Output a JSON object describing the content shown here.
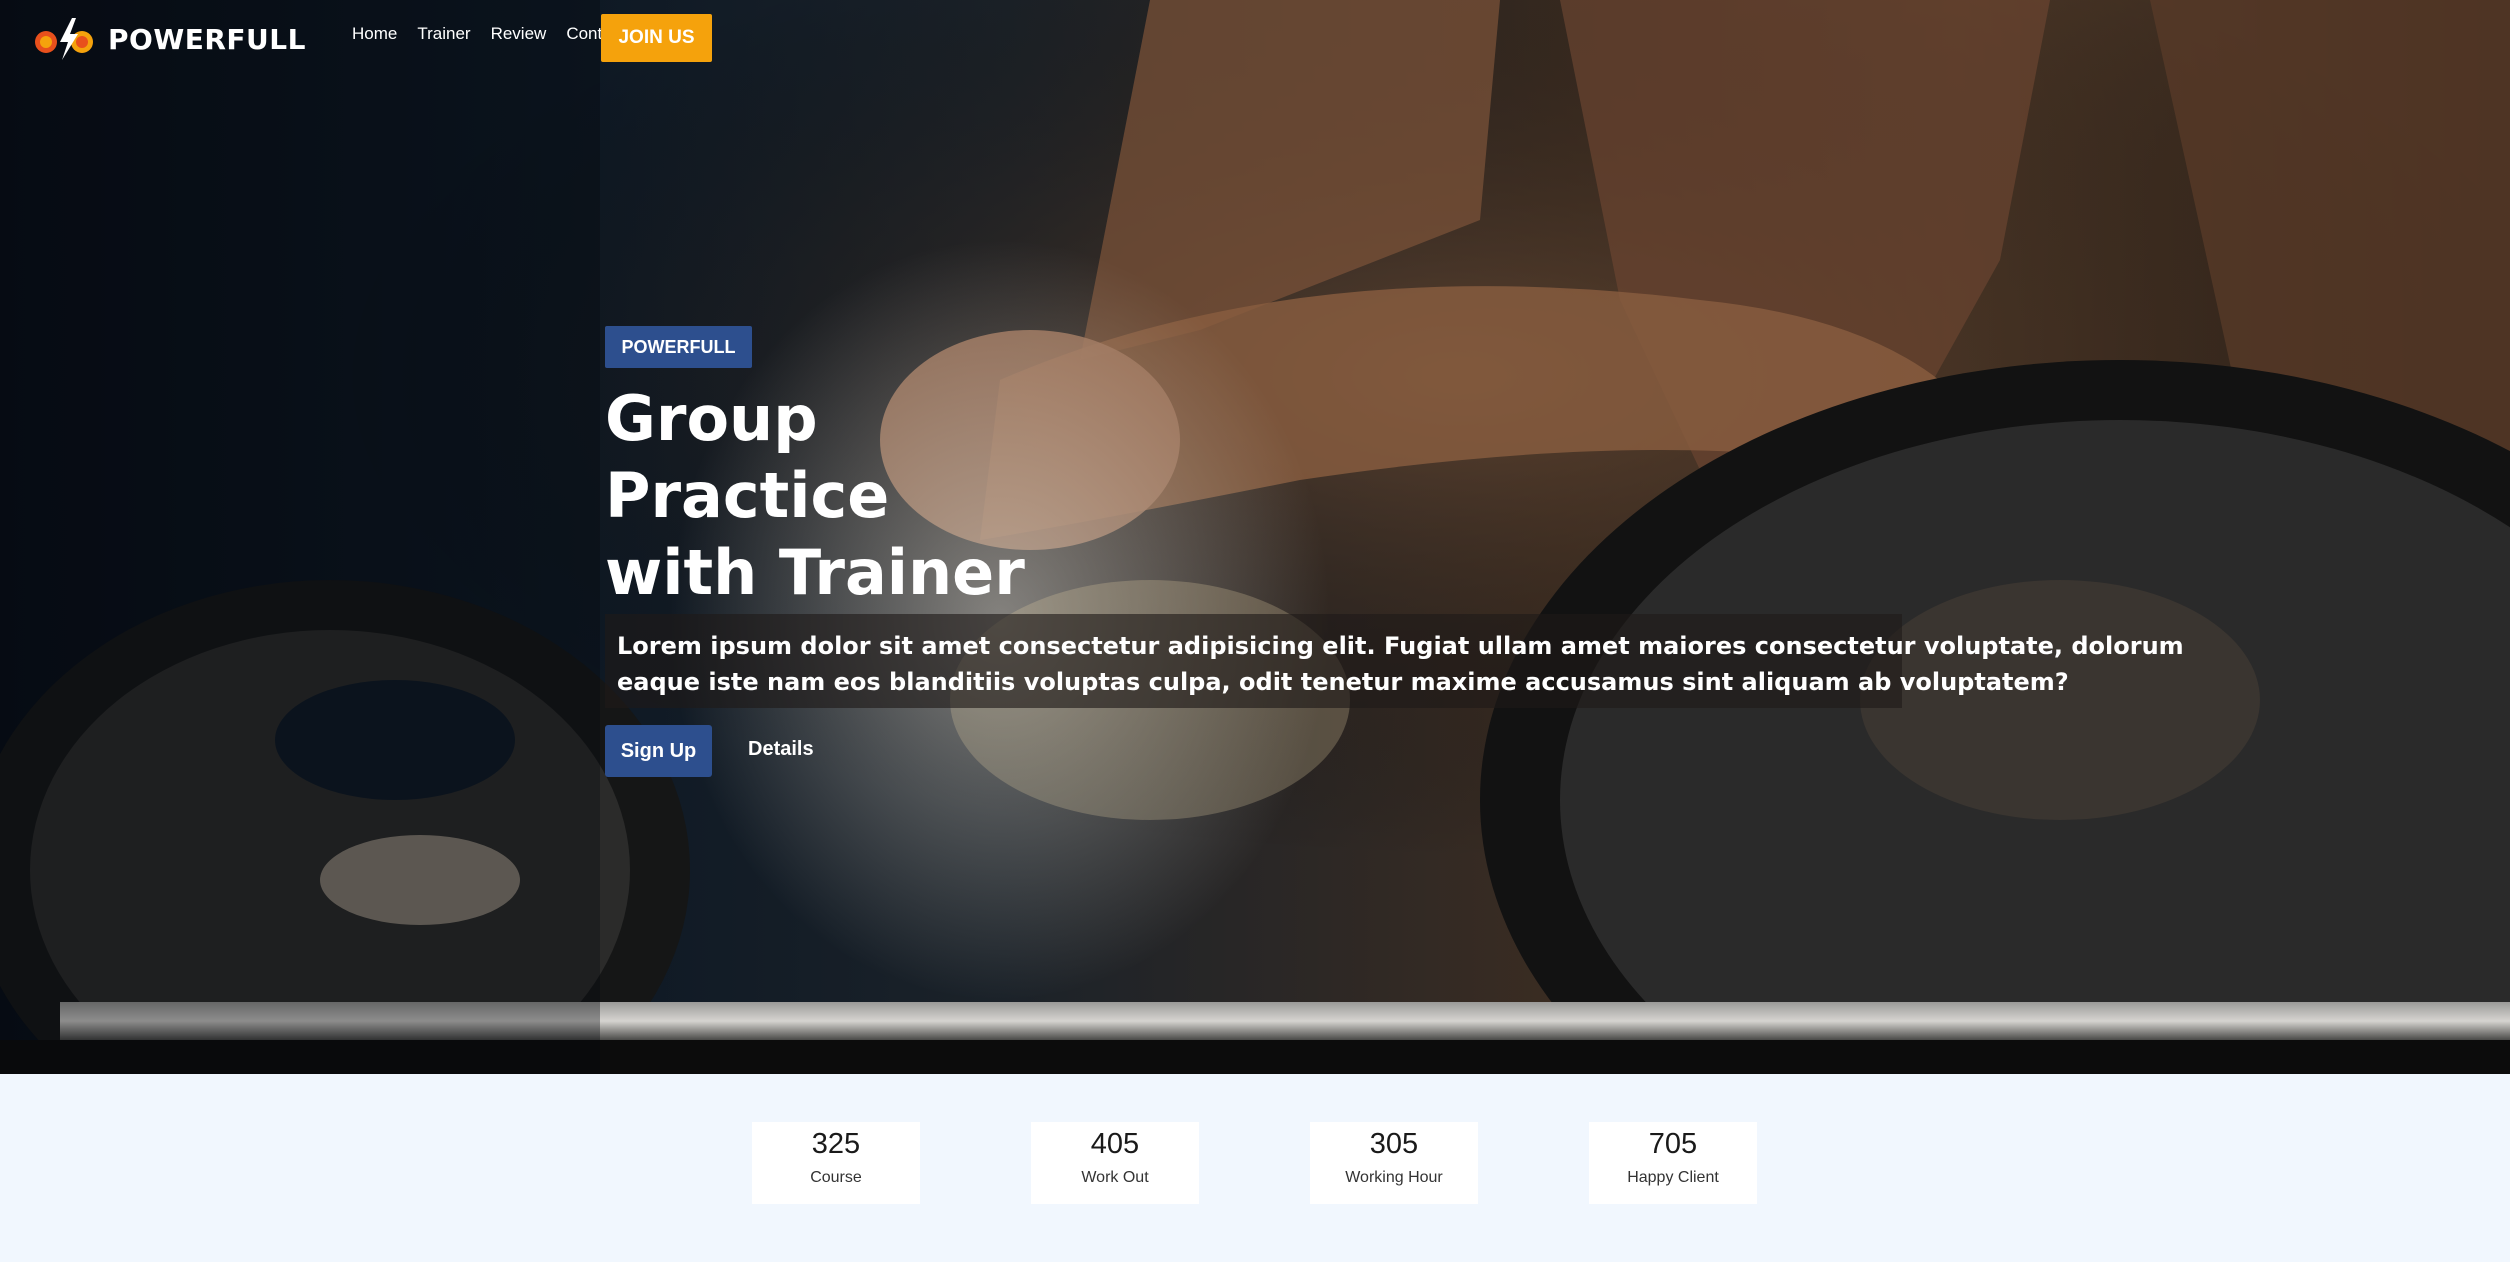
{
  "brand": {
    "name": "POWERFULL",
    "accent": "#f5a20c",
    "primary": "#2d4f8e"
  },
  "nav": {
    "items": [
      {
        "label": "Home"
      },
      {
        "label": "Trainer"
      },
      {
        "label": "Review"
      },
      {
        "label": "Contact"
      }
    ],
    "cta_label": "JOIN US"
  },
  "hero": {
    "badge": "POWERFULL",
    "headline_lines": [
      "Group",
      "Practice",
      "with Trainer"
    ],
    "description_lines": [
      "Lorem ipsum dolor sit amet consectetur adipisicing elit. Fugiat ullam amet maiores consectetur voluptate, dolorum",
      "eaque iste nam eos blanditiis voluptas culpa, odit tenetur maxime accusamus sint aliquam ab voluptatem?"
    ],
    "primary_button": "Sign Up",
    "secondary_link": "Details"
  },
  "stats": [
    {
      "value": "325",
      "label": "Course"
    },
    {
      "value": "405",
      "label": "Work Out"
    },
    {
      "value": "305",
      "label": "Working Hour"
    },
    {
      "value": "705",
      "label": "Happy Client"
    }
  ]
}
